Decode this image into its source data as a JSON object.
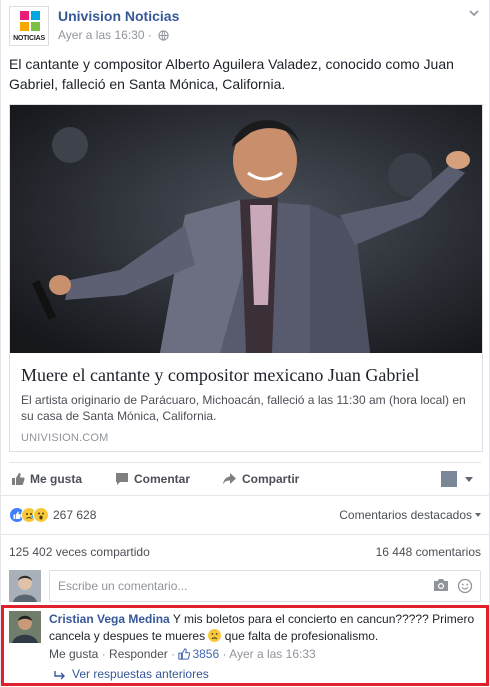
{
  "post": {
    "page_name": "Univision Noticias",
    "logo_text": "NOTICIAS",
    "timestamp": "Ayer a las 16:30",
    "meta_sep": "·",
    "text": "El cantante y compositor Alberto Aguilera Valadez, conocido como Juan Gabriel, falleció en Santa Mónica, California."
  },
  "link_card": {
    "title": "Muere el cantante y compositor mexicano Juan Gabriel",
    "description": "El artista originario de Parácuaro, Michoacán, falleció a las 11:30 am (hora local) en su casa de Santa Mónica, California.",
    "source": "UNIVISION.COM"
  },
  "actions": {
    "like": "Me gusta",
    "comment": "Comentar",
    "share": "Compartir"
  },
  "reactions": {
    "count": "267 628",
    "types": [
      "like",
      "sad",
      "wow"
    ],
    "featured_label": "Comentarios destacados"
  },
  "stats": {
    "shares": "125 402 veces compartido",
    "comments": "16 448 comentarios"
  },
  "composer": {
    "placeholder": "Escribe un comentario..."
  },
  "comment": {
    "author": "Cristian Vega Medina",
    "text_before": "Y mis boletos para el concierto en cancun????? Primero cancela y despues te mueres",
    "text_after": "que falta de profesionalismo.",
    "like_label": "Me gusta",
    "reply_label": "Responder",
    "likes": "3856",
    "sep": "·",
    "time": "Ayer a las 16:33",
    "view_replies": "Ver respuestas anteriores"
  },
  "colors": {
    "link_blue": "#365899",
    "highlight_red": "#e0212c",
    "like_blue": "#4080ff",
    "emoji_yellow": "#f7c93a"
  }
}
